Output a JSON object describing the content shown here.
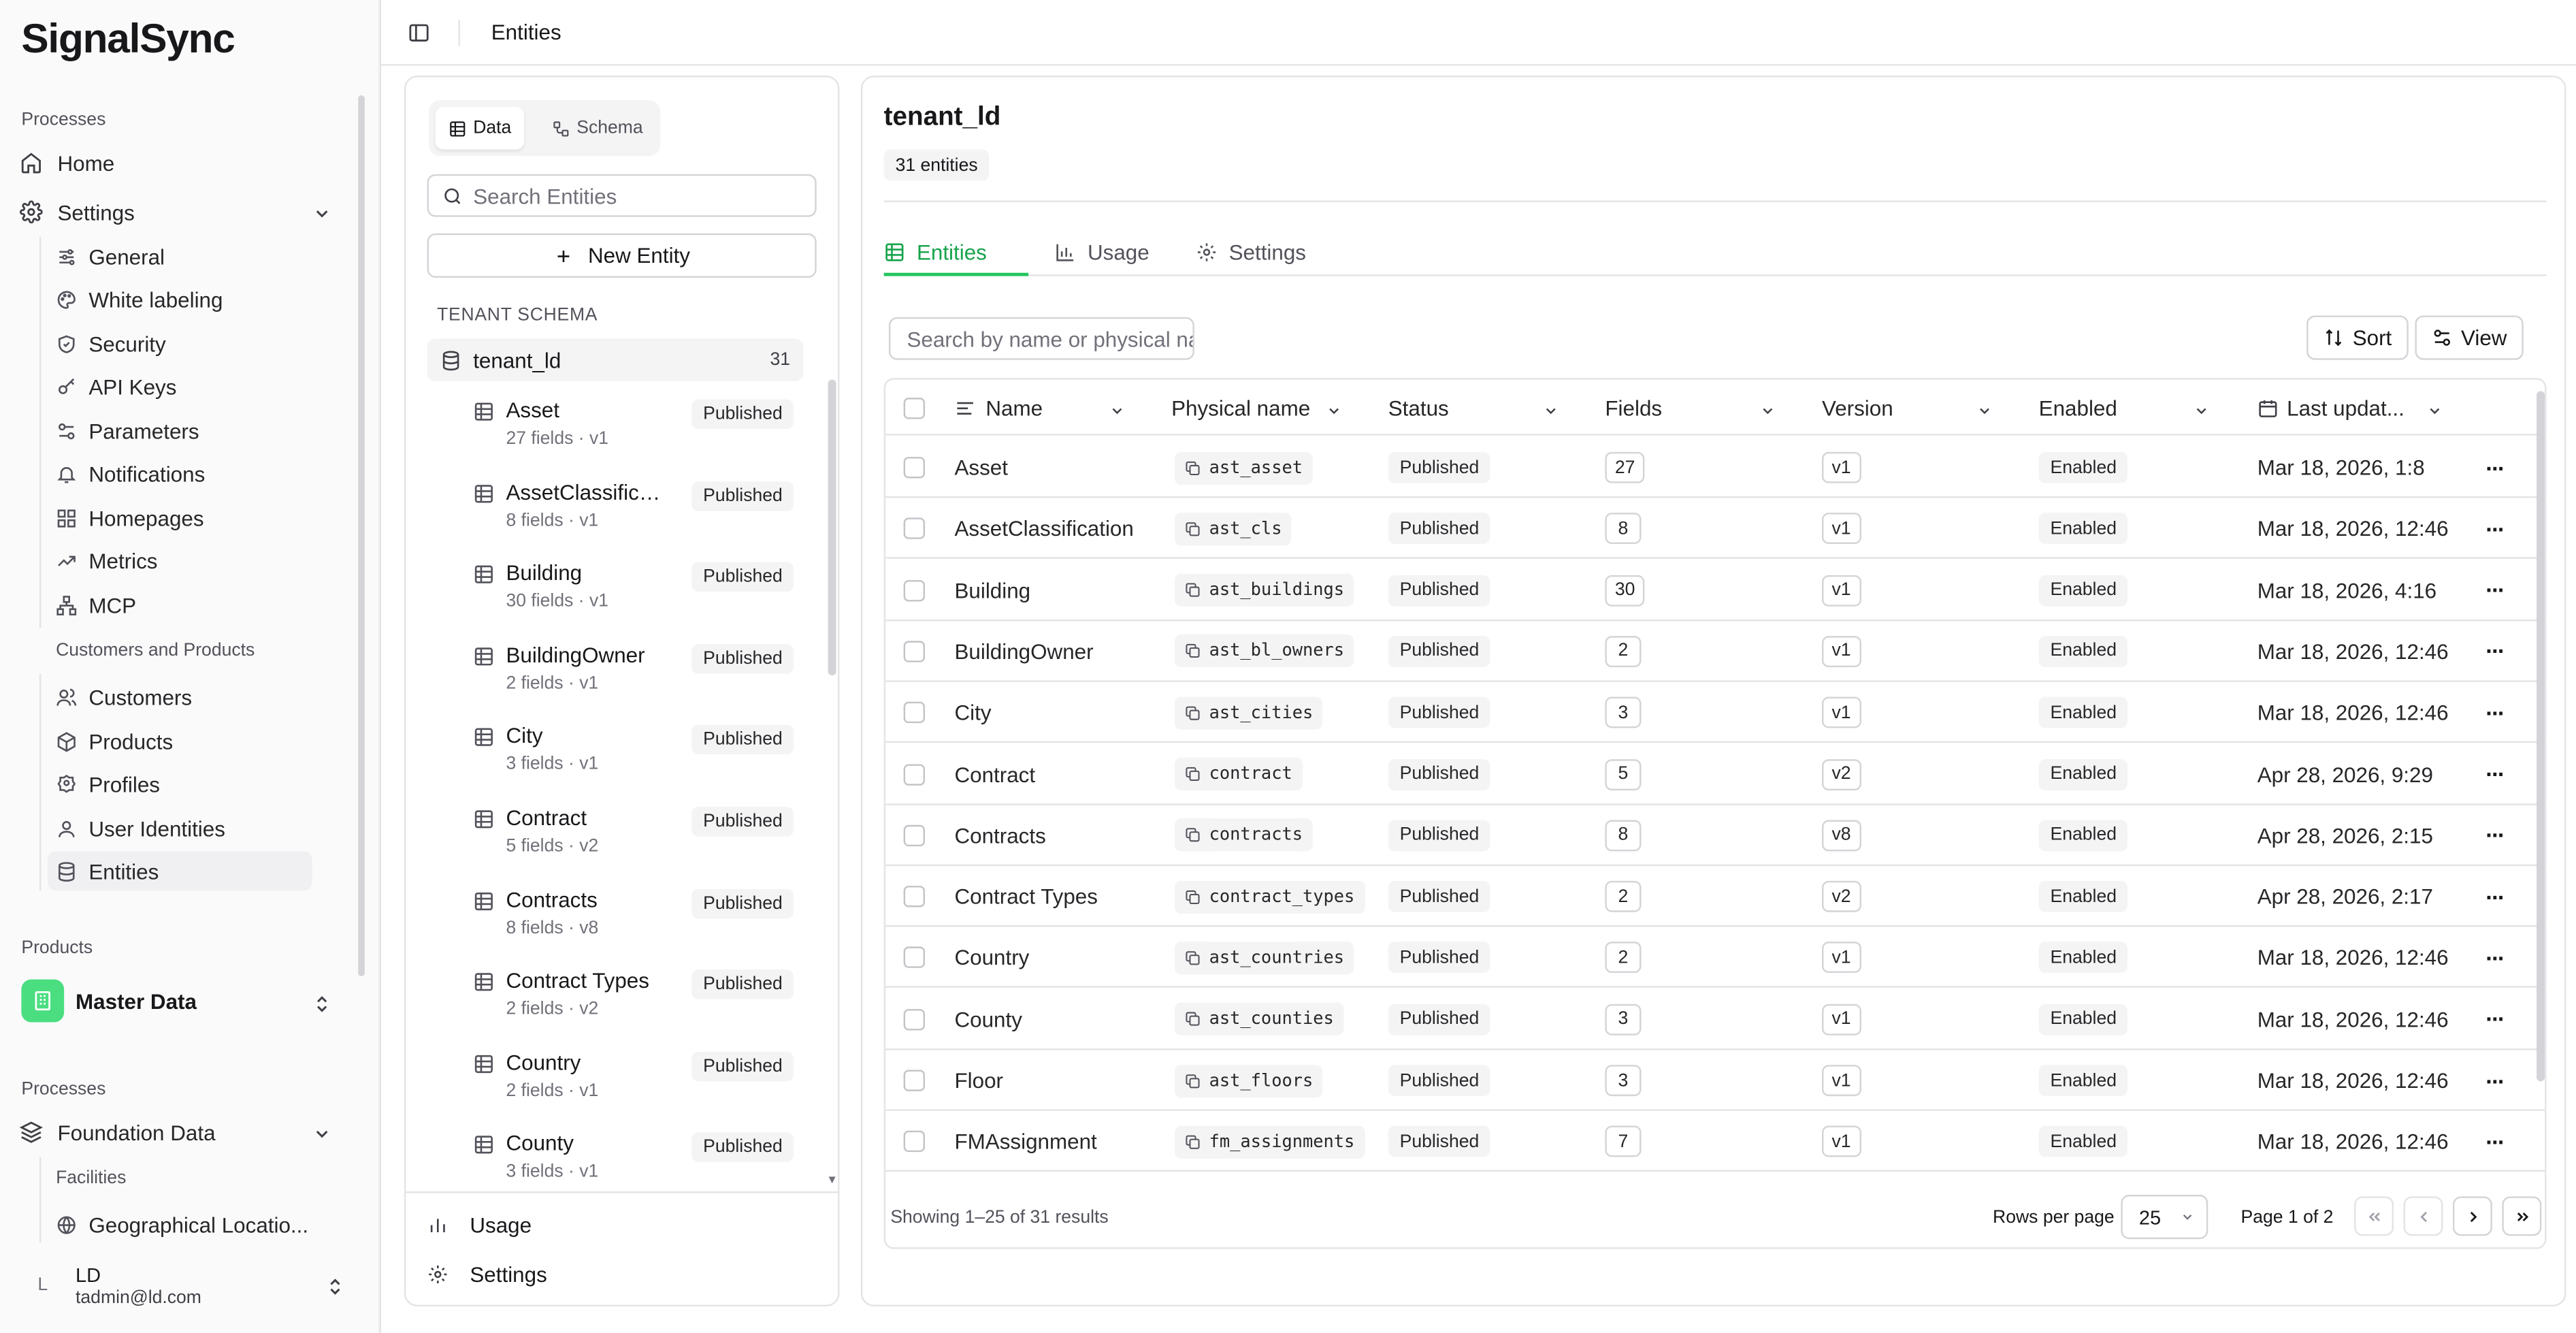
{
  "app": {
    "logo": "SignalSync"
  },
  "sidebar": {
    "section_processes": "Processes",
    "home": "Home",
    "settings": "Settings",
    "settings_items": [
      "General",
      "White labeling",
      "Security",
      "API Keys",
      "Parameters",
      "Notifications",
      "Homepages",
      "Metrics",
      "MCP"
    ],
    "customers_heading": "Customers and Products",
    "customer_items": [
      "Customers",
      "Products",
      "Profiles",
      "User Identities",
      "Entities"
    ],
    "section_products": "Products",
    "product_selected": "Master Data",
    "section_processes2": "Processes",
    "foundation": "Foundation Data",
    "foundation_sub_heading": "Facilities",
    "foundation_items": [
      "Geographical Locatio..."
    ],
    "user": {
      "initial": "L",
      "name": "LD",
      "email": "tadmin@ld.com"
    }
  },
  "topbar": {
    "title": "Entities"
  },
  "left_panel": {
    "seg_data": "Data",
    "seg_schema": "Schema",
    "search_placeholder": "Search Entities",
    "new_entity": "New Entity",
    "schema_heading": "TENANT SCHEMA",
    "root_name": "tenant_ld",
    "root_count": "31",
    "entities": [
      {
        "name": "Asset",
        "meta": "27 fields · v1",
        "status": "Published"
      },
      {
        "name": "AssetClassificati...",
        "meta": "8 fields · v1",
        "status": "Published"
      },
      {
        "name": "Building",
        "meta": "30 fields · v1",
        "status": "Published"
      },
      {
        "name": "BuildingOwner",
        "meta": "2 fields · v1",
        "status": "Published"
      },
      {
        "name": "City",
        "meta": "3 fields · v1",
        "status": "Published"
      },
      {
        "name": "Contract",
        "meta": "5 fields · v2",
        "status": "Published"
      },
      {
        "name": "Contracts",
        "meta": "8 fields · v8",
        "status": "Published"
      },
      {
        "name": "Contract Types",
        "meta": "2 fields · v2",
        "status": "Published"
      },
      {
        "name": "Country",
        "meta": "2 fields · v1",
        "status": "Published"
      },
      {
        "name": "County",
        "meta": "3 fields · v1",
        "status": "Published"
      }
    ],
    "footer_usage": "Usage",
    "footer_settings": "Settings"
  },
  "right_panel": {
    "title": "tenant_ld",
    "count": "31 entities",
    "tabs": [
      "Entities",
      "Usage",
      "Settings"
    ],
    "search_placeholder": "Search by name or physical na",
    "sort": "Sort",
    "view": "View",
    "columns": [
      "Name",
      "Physical name",
      "Status",
      "Fields",
      "Version",
      "Enabled",
      "Last updat..."
    ],
    "rows": [
      {
        "name": "Asset",
        "physical": "ast_asset",
        "status": "Published",
        "fields": "27",
        "version": "v1",
        "enabled": "Enabled",
        "updated": "Mar 18, 2026, 1:8"
      },
      {
        "name": "AssetClassification",
        "physical": "ast_cls",
        "status": "Published",
        "fields": "8",
        "version": "v1",
        "enabled": "Enabled",
        "updated": "Mar 18, 2026, 12:46"
      },
      {
        "name": "Building",
        "physical": "ast_buildings",
        "status": "Published",
        "fields": "30",
        "version": "v1",
        "enabled": "Enabled",
        "updated": "Mar 18, 2026, 4:16"
      },
      {
        "name": "BuildingOwner",
        "physical": "ast_bl_owners",
        "status": "Published",
        "fields": "2",
        "version": "v1",
        "enabled": "Enabled",
        "updated": "Mar 18, 2026, 12:46"
      },
      {
        "name": "City",
        "physical": "ast_cities",
        "status": "Published",
        "fields": "3",
        "version": "v1",
        "enabled": "Enabled",
        "updated": "Mar 18, 2026, 12:46"
      },
      {
        "name": "Contract",
        "physical": "contract",
        "status": "Published",
        "fields": "5",
        "version": "v2",
        "enabled": "Enabled",
        "updated": "Apr 28, 2026, 9:29"
      },
      {
        "name": "Contracts",
        "physical": "contracts",
        "status": "Published",
        "fields": "8",
        "version": "v8",
        "enabled": "Enabled",
        "updated": "Apr 28, 2026, 2:15"
      },
      {
        "name": "Contract Types",
        "physical": "contract_types",
        "status": "Published",
        "fields": "2",
        "version": "v2",
        "enabled": "Enabled",
        "updated": "Apr 28, 2026, 2:17"
      },
      {
        "name": "Country",
        "physical": "ast_countries",
        "status": "Published",
        "fields": "2",
        "version": "v1",
        "enabled": "Enabled",
        "updated": "Mar 18, 2026, 12:46"
      },
      {
        "name": "County",
        "physical": "ast_counties",
        "status": "Published",
        "fields": "3",
        "version": "v1",
        "enabled": "Enabled",
        "updated": "Mar 18, 2026, 12:46"
      },
      {
        "name": "Floor",
        "physical": "ast_floors",
        "status": "Published",
        "fields": "3",
        "version": "v1",
        "enabled": "Enabled",
        "updated": "Mar 18, 2026, 12:46"
      },
      {
        "name": "FMAssignment",
        "physical": "fm_assignments",
        "status": "Published",
        "fields": "7",
        "version": "v1",
        "enabled": "Enabled",
        "updated": "Mar 18, 2026, 12:46"
      }
    ],
    "showing": "Showing 1–25 of 31 results",
    "rows_per_page_label": "Rows per page",
    "rows_per_page": "25",
    "page_label": "Page 1 of 2"
  },
  "colors": {
    "accent": "#22c55e",
    "project_badge": "#4ade80"
  }
}
